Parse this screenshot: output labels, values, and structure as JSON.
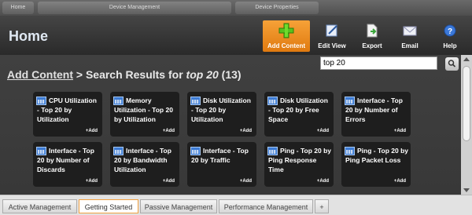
{
  "top_tabs": [
    "Home",
    "Device Management",
    "Device Properties"
  ],
  "page_title": "Home",
  "toolbar": {
    "add_content": "Add Content",
    "edit_view": "Edit View",
    "export": "Export",
    "email": "Email",
    "help": "Help"
  },
  "search": {
    "value": "top 20"
  },
  "breadcrumb": {
    "link": "Add Content",
    "sep": " > Search Results for ",
    "query": "top 20",
    "count": " (13)"
  },
  "cards": [
    {
      "title": "CPU Utilization - Top 20 by Utilization",
      "add": "+Add"
    },
    {
      "title": "Memory Utilization - Top 20 by Utilization",
      "add": "+Add"
    },
    {
      "title": "Disk Utilization - Top 20 by Utilization",
      "add": "+Add"
    },
    {
      "title": "Disk Utilization - Top 20 by Free Space",
      "add": "+Add"
    },
    {
      "title": "Interface - Top 20 by Number of Errors",
      "add": "+Add"
    },
    {
      "title": "Interface - Top 20 by Number of Discards",
      "add": "+Add"
    },
    {
      "title": "Interface - Top 20 by Bandwidth Utilization",
      "add": "+Add"
    },
    {
      "title": "Interface - Top 20 by Traffic",
      "add": "+Add"
    },
    {
      "title": "Ping - Top 20 by Ping Response Time",
      "add": "+Add"
    },
    {
      "title": "Ping - Top 20 by Ping Packet Loss",
      "add": "+Add"
    }
  ],
  "bottom_tabs": [
    "Active Management",
    "Getting Started",
    "Passive Management",
    "Performance Management",
    "+"
  ],
  "colors": {
    "accent": "#f08a1c",
    "card_bg": "#1e1e1e",
    "header_bg": "#2f2f2f"
  }
}
